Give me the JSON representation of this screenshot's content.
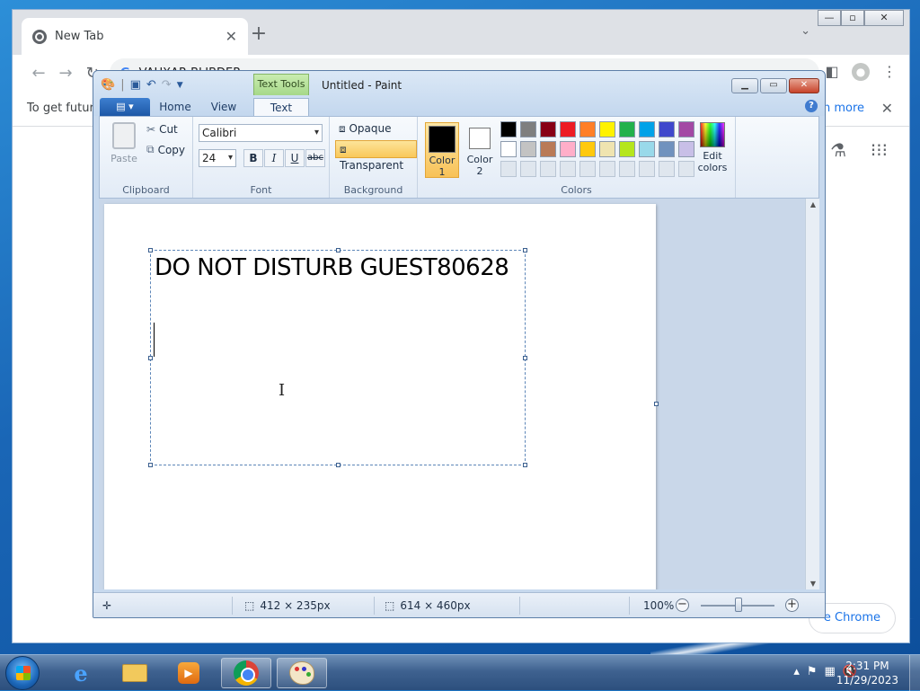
{
  "chrome": {
    "tab_title": "New Tab",
    "tab_close": "✕",
    "new_tab": "+",
    "tab_search": "⌄",
    "win_min": "—",
    "win_max": "▫",
    "win_close": "✕",
    "omnibox_text": "VAUXAR BLIBDER",
    "omnibox_g": "G",
    "infobar_text": "To get future",
    "infobar_link": "n more",
    "infobar_close": "✕",
    "customize_label": "e Chrome"
  },
  "paint": {
    "window_title": "Untitled - Paint",
    "context_tab": "Text Tools",
    "tabs": [
      "Home",
      "View",
      "Text"
    ],
    "active_tab": "Text",
    "help": "?",
    "clipboard": {
      "paste": "Paste",
      "cut": "Cut",
      "copy": "Copy",
      "label": "Clipboard"
    },
    "font": {
      "family": "Calibri",
      "size": "24",
      "bold": "B",
      "italic": "I",
      "underline": "U",
      "strike": "abc",
      "label": "Font"
    },
    "background": {
      "opaque": "Opaque",
      "transparent": "Transparent",
      "label": "Background",
      "selected": "Transparent"
    },
    "colors": {
      "label": "Colors",
      "color1_label": "Color 1",
      "color1_label_a": "Color",
      "color1_label_b": "1",
      "color2_label_a": "Color",
      "color2_label_b": "2",
      "color1": "#000000",
      "color2": "#ffffff",
      "edit_label_a": "Edit",
      "edit_label_b": "colors",
      "palette_row1": [
        "#000000",
        "#7f7f7f",
        "#880015",
        "#ed1c24",
        "#ff7f27",
        "#fff200",
        "#22b14c",
        "#00a2e8",
        "#3f48cc",
        "#a349a4"
      ],
      "palette_row2": [
        "#ffffff",
        "#c3c3c3",
        "#b97a57",
        "#ffaec9",
        "#ffc90e",
        "#efe4b0",
        "#b5e61d",
        "#99d9ea",
        "#7092be",
        "#c8bfe7"
      ],
      "palette_row3": [
        "#dfe6ee",
        "#dfe6ee",
        "#dfe6ee",
        "#dfe6ee",
        "#dfe6ee",
        "#dfe6ee",
        "#dfe6ee",
        "#dfe6ee",
        "#dfe6ee",
        "#dfe6ee"
      ]
    },
    "canvas_text": "DO NOT DISTURB GUEST80628",
    "status": {
      "selection_size": "412 × 235px",
      "canvas_size": "614 × 460px",
      "zoom": "100%"
    }
  },
  "taskbar": {
    "time": "2:31 PM",
    "date": "11/29/2023"
  }
}
